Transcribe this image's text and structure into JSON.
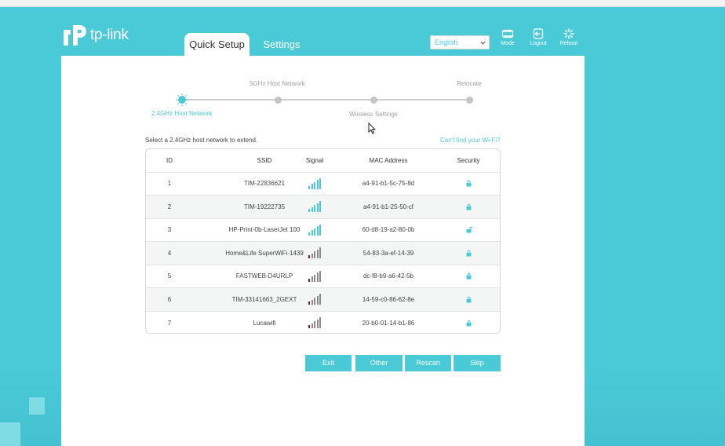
{
  "header": {
    "brand": "tp-link",
    "tabs": [
      {
        "label": "Quick Setup",
        "active": true
      },
      {
        "label": "Settings",
        "active": false
      }
    ],
    "language": "English",
    "buttons": [
      {
        "label": "Mode",
        "icon": "mode-icon"
      },
      {
        "label": "Logout",
        "icon": "logout-icon"
      },
      {
        "label": "Reboot",
        "icon": "reboot-icon"
      }
    ]
  },
  "stepper": {
    "steps": [
      {
        "label": "2.4GHz Host Network",
        "active": true
      },
      {
        "label": "5GHz Host Network",
        "active": false
      },
      {
        "label": "Wireless Settings",
        "active": false
      },
      {
        "label": "Relocate",
        "active": false
      }
    ]
  },
  "instructions": "Select a 2.4GHz host network to extend.",
  "cant_find_link": "Can't find your Wi-Fi?",
  "table": {
    "columns": [
      "ID",
      "SSID",
      "Signal",
      "MAC Address",
      "Security"
    ],
    "rows": [
      {
        "id": "1",
        "ssid": "TIM-22836621",
        "signal": 5,
        "mac": "a4-91-b1-5c-75-8d",
        "locked": true
      },
      {
        "id": "2",
        "ssid": "TIM-19222735",
        "signal": 5,
        "mac": "a4-91-b1-25-50-cf",
        "locked": true
      },
      {
        "id": "3",
        "ssid": "HP-Print-0b-LaserJet 100",
        "signal": 5,
        "mac": "60-d8-19-a2-80-0b",
        "locked": false
      },
      {
        "id": "4",
        "ssid": "Home&Life SuperWiFi-1439",
        "signal": 1,
        "mac": "54-83-3a-ef-14-39",
        "locked": true
      },
      {
        "id": "5",
        "ssid": "FASTWEB-D4URLP",
        "signal": 1,
        "mac": "dc-f8-b9-a6-42-5b",
        "locked": true
      },
      {
        "id": "6",
        "ssid": "TIM-33141663_2GEXT",
        "signal": 1,
        "mac": "14-59-c0-86-62-8e",
        "locked": true
      },
      {
        "id": "7",
        "ssid": "Lucawifi",
        "signal": 1,
        "mac": "20-b0-01-14-b1-86",
        "locked": true
      }
    ]
  },
  "buttons": {
    "exit": "Exit",
    "other": "Other",
    "rescan": "Rescan",
    "skip": "Skip"
  },
  "colors": {
    "accent": "#4ac9d6",
    "weak_signal": "#8b1a1a",
    "inactive_bar": "#8a8a8a"
  }
}
